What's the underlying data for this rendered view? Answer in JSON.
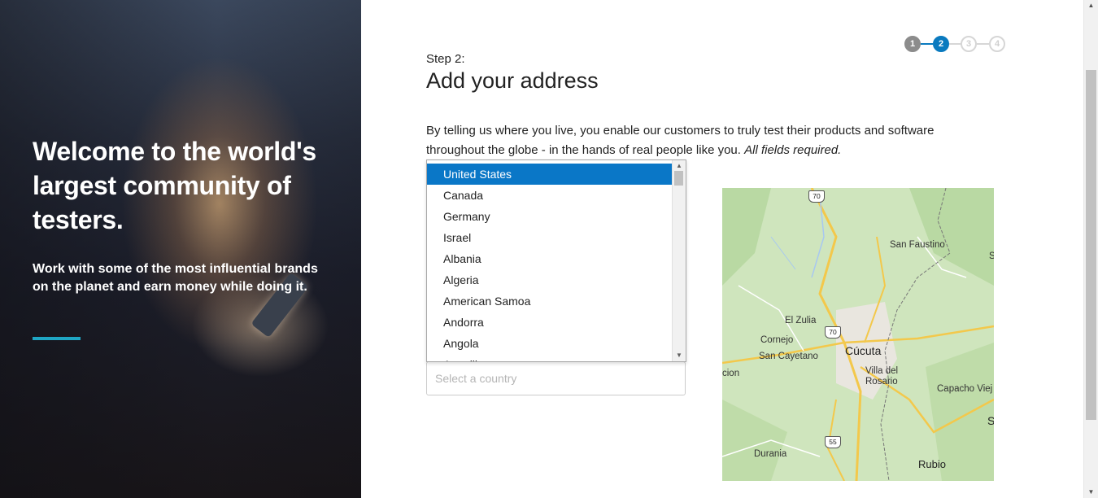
{
  "hero": {
    "heading": "Welcome to the world's largest community of testers.",
    "subheading": "Work with some of the most influential brands on the planet and earn money while doing it."
  },
  "steps": {
    "items": [
      "1",
      "2",
      "3",
      "4"
    ],
    "current": 2
  },
  "form": {
    "step_label": "Step 2:",
    "title": "Add your address",
    "description": "By telling us where you live, you enable our customers to truly test their products and software throughout the globe - in the hands of real people like you.",
    "required_note": "All fields required.",
    "country_placeholder": "Select a country"
  },
  "dropdown": {
    "selected": "United States",
    "options": [
      "United States",
      "Canada",
      "Germany",
      "Israel",
      "Albania",
      "Algeria",
      "American Samoa",
      "Andorra",
      "Angola",
      "Anguilla"
    ]
  },
  "map": {
    "labels": [
      "San Faustino",
      "El Zulia",
      "Cornejo",
      "San Cayetano",
      "Cúcuta",
      "Villa del",
      "Rosario",
      "Capacho Viej",
      "Durania",
      "Rubio",
      "cion",
      "S",
      "S"
    ],
    "route_shields": [
      "70",
      "70",
      "55"
    ]
  },
  "colors": {
    "accent": "#0a7abf",
    "hero_accent": "#1fa6c4",
    "selected_option": "#0a77c7"
  }
}
